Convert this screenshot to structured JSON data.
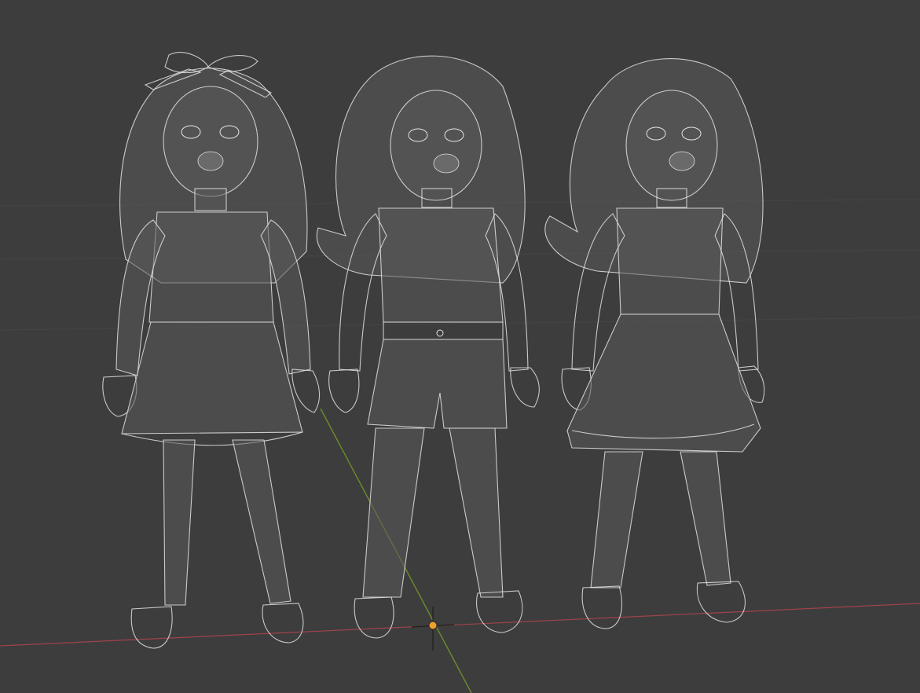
{
  "viewport": {
    "background": "#3d3d3d",
    "grid_color": "#444444",
    "x_axis_color": "#a0434a",
    "y_axis_color": "#6c8c2b",
    "origin_color": "#f0a030",
    "wire_color": "#c9c9c9"
  },
  "scene": {
    "objects": [
      {
        "name": "doll-with-bow-and-skirt",
        "outfit": "dress"
      },
      {
        "name": "doll-with-shorts",
        "outfit": "shorts"
      },
      {
        "name": "doll-with-flared-dress",
        "outfit": "flared-dress"
      }
    ],
    "display_mode": "wireframe"
  }
}
